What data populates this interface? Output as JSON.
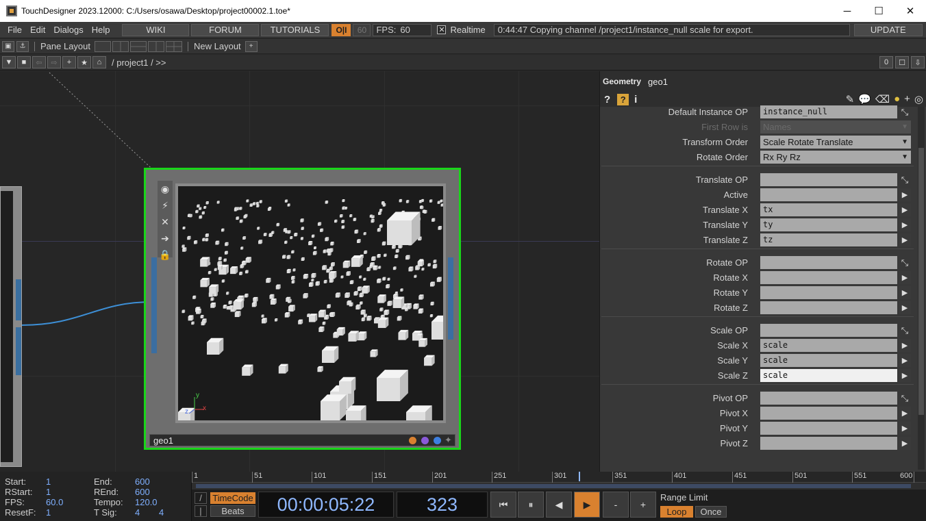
{
  "window": {
    "title": "TouchDesigner 2023.12000: C:/Users/osawa/Desktop/project00002.1.toe*",
    "minimize": "─",
    "maximize": "☐",
    "close": "✕"
  },
  "menubar": {
    "file": "File",
    "edit": "Edit",
    "dialogs": "Dialogs",
    "help": "Help",
    "wiki": "WIKI",
    "forum": "FORUM",
    "tutorials": "TUTORIALS",
    "oi": "O|I",
    "fps_target": "60",
    "fps_label": "FPS:",
    "fps_value": "60",
    "realtime_check": "✕",
    "realtime_label": "Realtime",
    "status": "0:44:47 Copying channel /project1/instance_null scale for export.",
    "update": "UPDATE"
  },
  "panebar": {
    "pane_layout": "Pane Layout",
    "new_layout": "New Layout",
    "add": "+"
  },
  "pathbar": {
    "path": "/ project1 / >>",
    "count": "0"
  },
  "network": {
    "geo_node_name": "geo1",
    "axis_y": "y",
    "axis_x": "x",
    "axis_z": "z"
  },
  "params": {
    "op_type": "Geometry",
    "op_name": "geo1",
    "rows": {
      "default_instance_op": {
        "label": "Default Instance OP",
        "value": "instance_null"
      },
      "first_row_is": {
        "label": "First Row is",
        "value": "Names"
      },
      "transform_order": {
        "label": "Transform Order",
        "value": "Scale Rotate Translate"
      },
      "rotate_order": {
        "label": "Rotate Order",
        "value": "Rx Ry Rz"
      },
      "translate_op": {
        "label": "Translate OP",
        "value": ""
      },
      "active": {
        "label": "Active",
        "value": ""
      },
      "translate_x": {
        "label": "Translate X",
        "value": "tx"
      },
      "translate_y": {
        "label": "Translate Y",
        "value": "ty"
      },
      "translate_z": {
        "label": "Translate Z",
        "value": "tz"
      },
      "rotate_op": {
        "label": "Rotate OP",
        "value": ""
      },
      "rotate_x": {
        "label": "Rotate X",
        "value": ""
      },
      "rotate_y": {
        "label": "Rotate Y",
        "value": ""
      },
      "rotate_z": {
        "label": "Rotate Z",
        "value": ""
      },
      "scale_op": {
        "label": "Scale OP",
        "value": ""
      },
      "scale_x": {
        "label": "Scale X",
        "value": "scale"
      },
      "scale_y": {
        "label": "Scale Y",
        "value": "scale"
      },
      "scale_z": {
        "label": "Scale Z",
        "value": "scale"
      },
      "pivot_op": {
        "label": "Pivot OP",
        "value": ""
      },
      "pivot_x": {
        "label": "Pivot X",
        "value": ""
      },
      "pivot_y": {
        "label": "Pivot Y",
        "value": ""
      },
      "pivot_z": {
        "label": "Pivot Z",
        "value": ""
      }
    }
  },
  "timeline": {
    "start_label": "Start:",
    "start": "1",
    "end_label": "End:",
    "end": "600",
    "rstart_label": "RStart:",
    "rstart": "1",
    "rend_label": "REnd:",
    "rend": "600",
    "fps_label": "FPS:",
    "fps": "60.0",
    "tempo_label": "Tempo:",
    "tempo": "120.0",
    "resetf_label": "ResetF:",
    "resetf": "1",
    "tsig_label": "T Sig:",
    "tsig_a": "4",
    "tsig_b": "4",
    "ruler_ticks": [
      "1",
      "51",
      "101",
      "151",
      "201",
      "251",
      "301",
      "351",
      "401",
      "451",
      "501",
      "551",
      "600"
    ],
    "current_frame_ratio": 0.537,
    "timecode_btn": "TimeCode",
    "beats_btn": "Beats",
    "timecode": "00:00:05:22",
    "frame": "323",
    "minus": "-",
    "plus": "+",
    "range_limit": "Range Limit",
    "loop": "Loop",
    "once": "Once"
  },
  "colors": {
    "accent_orange": "#d9812f",
    "node_selected": "#19d619",
    "wire_blue": "#3d8fd6",
    "timecode_blue": "#8fb8ff"
  }
}
